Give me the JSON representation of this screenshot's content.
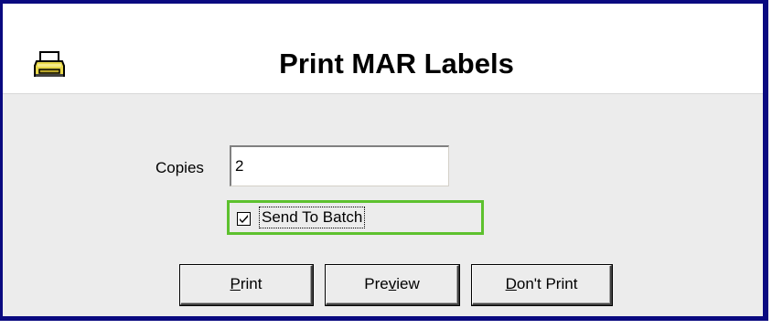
{
  "dialog": {
    "title": "Print MAR Labels",
    "icon": "printer-icon"
  },
  "form": {
    "copies_label": "Copies",
    "copies_value": "2",
    "send_to_batch_label": "Send To Batch",
    "send_to_batch_checked": true
  },
  "buttons": {
    "print": {
      "pre": "",
      "mnemonic": "P",
      "post": "rint"
    },
    "preview": {
      "pre": "Pre",
      "mnemonic": "v",
      "post": "iew"
    },
    "dont_print": {
      "pre": "",
      "mnemonic": "D",
      "post": "on't Print"
    }
  },
  "colors": {
    "window_border": "#0a0a80",
    "highlight_border": "#5dc12e",
    "dialog_background": "#ececec"
  }
}
